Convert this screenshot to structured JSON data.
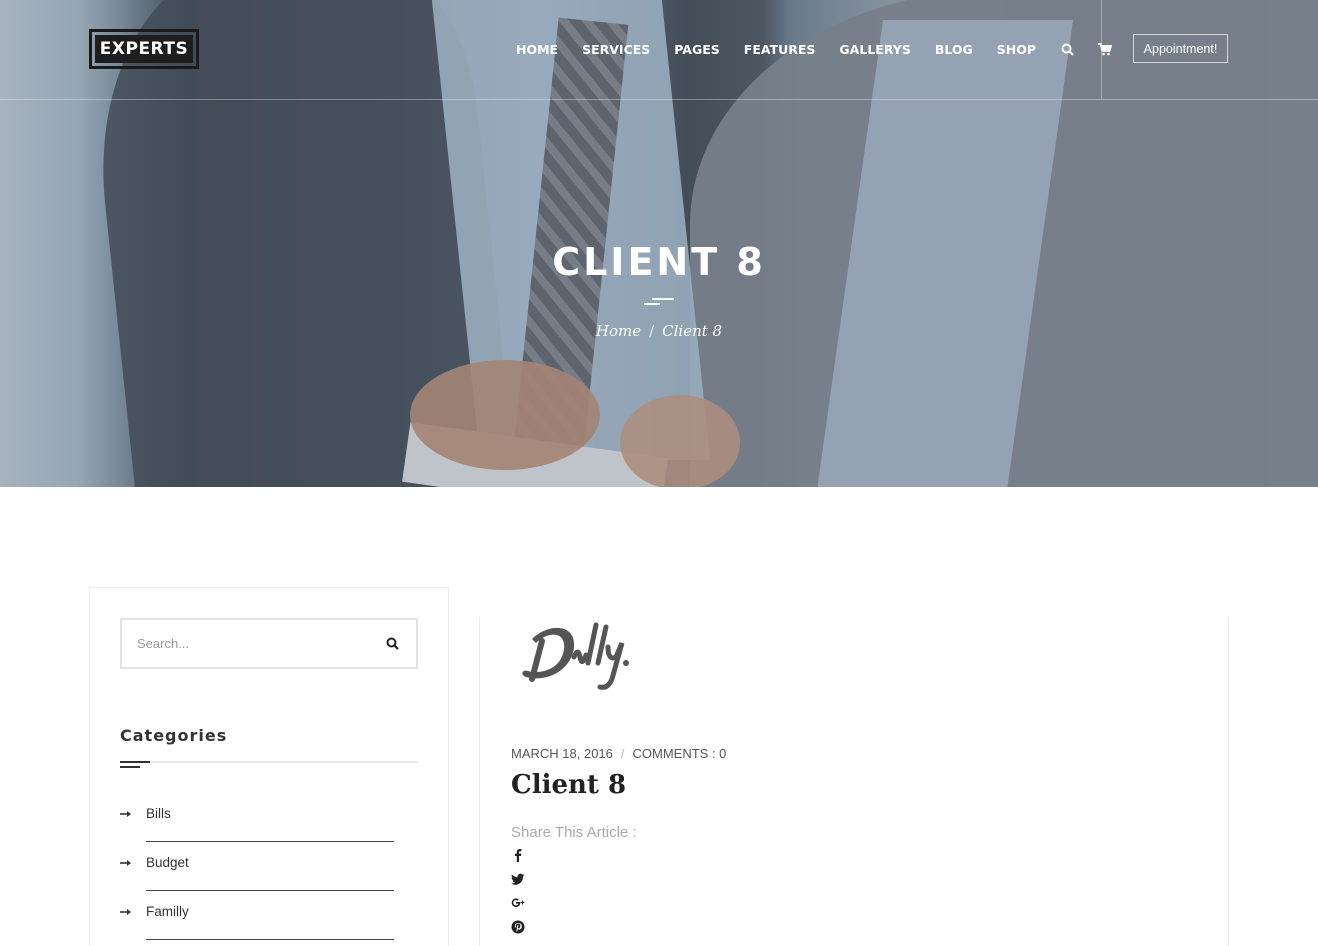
{
  "header": {
    "logo_text": "EXPERTS",
    "nav": [
      "HOME",
      "SERVICES",
      "PAGES",
      "FEATURES",
      "GALLERYS",
      "BLOG",
      "SHOP"
    ],
    "appointment_label": "Appointment!"
  },
  "hero": {
    "title": "CLIENT 8",
    "breadcrumb": {
      "home": "Home",
      "separator": "/",
      "current": "Client 8"
    }
  },
  "sidebar": {
    "search_placeholder": "Search...",
    "categories_title": "Categories",
    "categories": [
      "Bills",
      "Budget",
      "Familly"
    ]
  },
  "post": {
    "date": "MARCH 18, 2016",
    "meta_separator": "/",
    "comments": "COMMENTS : 0",
    "title": "Client 8",
    "share_label": "Share This Article :"
  },
  "colors": {
    "text_dark": "#222222",
    "text_muted": "#aaaaaa",
    "border_light": "#ececec"
  },
  "icons": [
    "search-icon",
    "cart-icon",
    "facebook-icon",
    "twitter-icon",
    "google-plus-icon",
    "pinterest-icon",
    "arrow-right-icon"
  ]
}
